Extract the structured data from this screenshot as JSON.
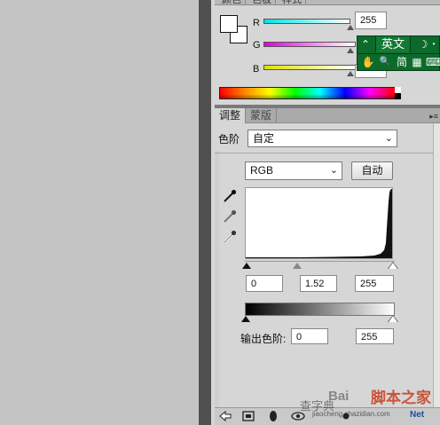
{
  "color_panel": {
    "tabs": [
      "颜色",
      "色板",
      "样式"
    ],
    "channels": [
      {
        "label": "R",
        "value": "255",
        "gradient": [
          "#00e5e5",
          "#ffffff"
        ]
      },
      {
        "label": "G",
        "value": "",
        "gradient": [
          "#e000e0",
          "#ffffff"
        ]
      },
      {
        "label": "B",
        "value": "",
        "gradient": [
          "#e0e000",
          "#ffffff"
        ]
      }
    ],
    "foreground": "#ffffff",
    "background": "#ffffff"
  },
  "ime": {
    "collapse_icon": "double-chevron-up-icon",
    "collapse_glyph": "⌃",
    "mode_label": "英文",
    "moon_glyph": "☽",
    "dot_glyph": "•",
    "hand_glyph": "✋",
    "search_glyph": "🔍",
    "simplified_label": "简",
    "grid_glyph": "▦",
    "keyboard_glyph": "⌨"
  },
  "adjustments": {
    "tabs": [
      "调整",
      "蒙版"
    ],
    "preset_label": "色阶",
    "preset_value": "自定",
    "channel_value": "RGB",
    "auto_label": "自动",
    "input_levels": [
      "0",
      "1.52",
      "255"
    ],
    "output_label": "输出色阶:",
    "output_levels": [
      "0",
      "255"
    ],
    "panel_menu_glyph": "▸≡",
    "dropdown_glyph": "⌄"
  },
  "bottom_toolbar": {
    "icons": [
      "back-arrow-icon",
      "expand-view-icon",
      "clip-layer-icon",
      "visibility-eye-icon",
      "reset-icon",
      "reset-all-icon",
      "delete-icon"
    ]
  },
  "watermark": {
    "baidu": "Bai",
    "jiaoben": "脚本之家",
    "chazi": "查字典",
    "url": "jiaocheng.chazidian.com",
    "net": "Net"
  },
  "colors": {
    "panel_bg": "#d6d6d6",
    "ime_green": "#0c6a2a",
    "workspace": "#c3c3c3"
  }
}
